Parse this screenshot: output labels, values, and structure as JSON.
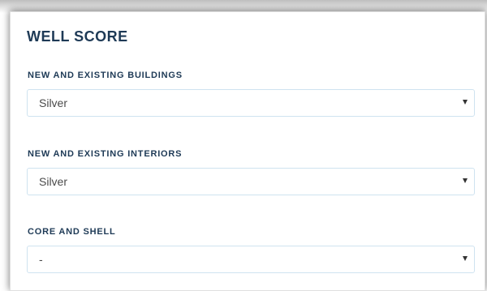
{
  "section": {
    "title": "WELL SCORE"
  },
  "fields": [
    {
      "label": "NEW AND EXISTING BUILDINGS",
      "selected": "Silver",
      "icon": "chevron-down-icon"
    },
    {
      "label": "NEW AND EXISTING INTERIORS",
      "selected": "Silver",
      "icon": "chevron-down-icon"
    },
    {
      "label": "CORE AND SHELL",
      "selected": "-",
      "icon": "chevron-down-icon"
    }
  ],
  "colors": {
    "heading": "#1e3a56",
    "select_border": "#cfe3f0",
    "value_text": "#4a4a4a"
  }
}
